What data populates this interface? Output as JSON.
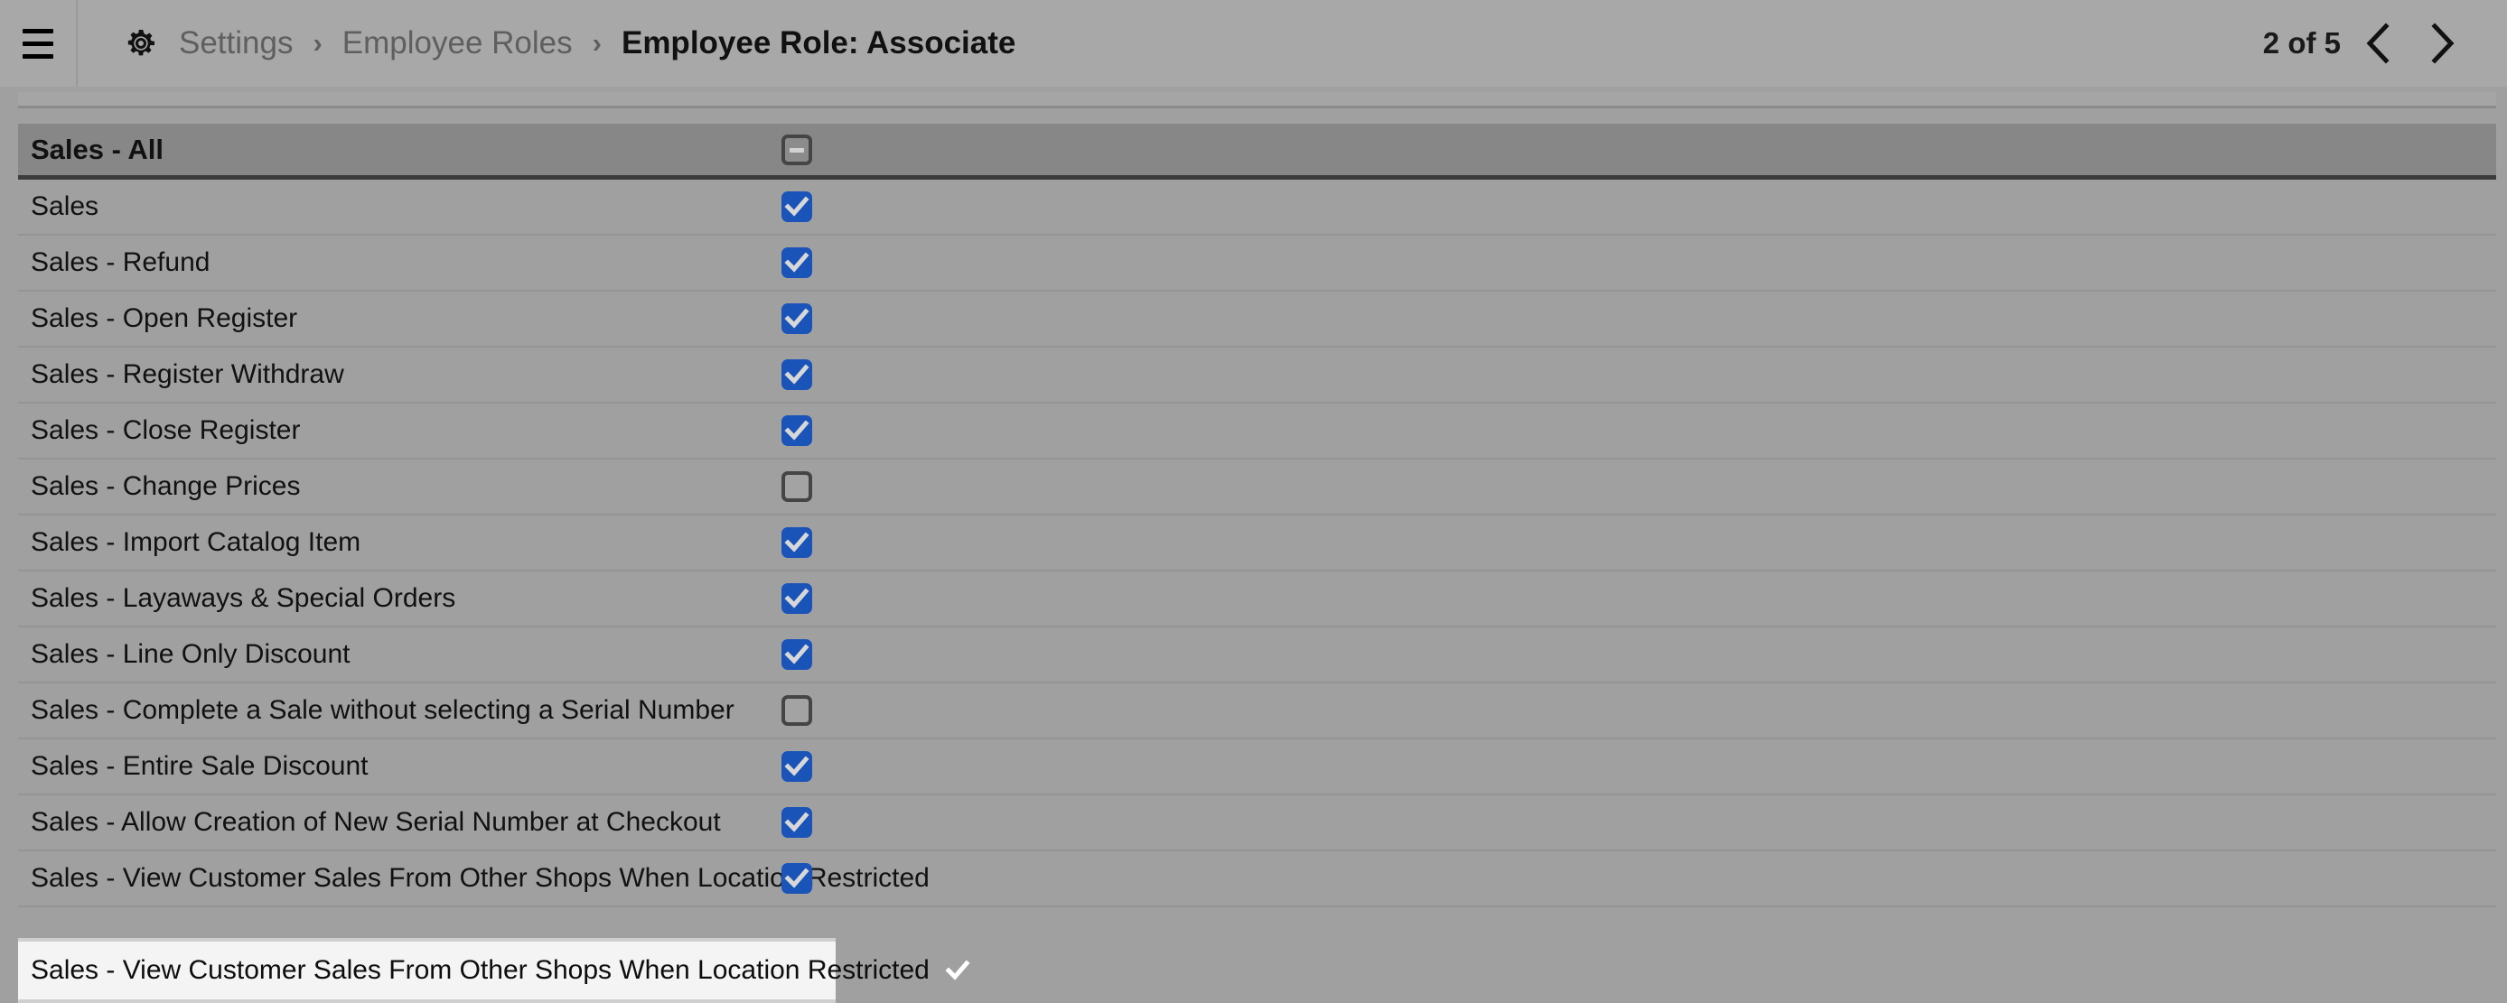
{
  "header": {
    "menu_icon": "hamburger-icon",
    "gear_icon": "gear-icon",
    "breadcrumb": {
      "items": [
        {
          "label": "Settings",
          "current": false
        },
        {
          "label": "Employee Roles",
          "current": false
        }
      ],
      "separator": "›",
      "current_prefix": "Employee Role:",
      "current_value": "Associate"
    },
    "pager": {
      "count_label": "2 of 5",
      "prev_icon": "chevron-left-icon",
      "next_icon": "chevron-right-icon"
    }
  },
  "permissions_table": {
    "group": {
      "label": "Sales - All",
      "checkbox_state": "indeterminate"
    },
    "rows": [
      {
        "label": "Sales",
        "checked": true
      },
      {
        "label": "Sales - Refund",
        "checked": true
      },
      {
        "label": "Sales - Open Register",
        "checked": true
      },
      {
        "label": "Sales - Register Withdraw",
        "checked": true
      },
      {
        "label": "Sales - Close Register",
        "checked": true
      },
      {
        "label": "Sales - Change Prices",
        "checked": false
      },
      {
        "label": "Sales - Import Catalog Item",
        "checked": true
      },
      {
        "label": "Sales - Layaways & Special Orders",
        "checked": true
      },
      {
        "label": "Sales - Line Only Discount",
        "checked": true
      },
      {
        "label": "Sales - Complete a Sale without selecting a Serial Number",
        "checked": false
      },
      {
        "label": "Sales - Entire Sale Discount",
        "checked": true
      },
      {
        "label": "Sales - Allow Creation of New Serial Number at Checkout",
        "checked": true
      },
      {
        "label": "Sales - View Customer Sales From Other Shops When Location Restricted",
        "checked": true
      }
    ]
  },
  "focused_row": {
    "label": "Sales - View Customer Sales From Other Shops When Location Restricted",
    "checked": true
  },
  "colors": {
    "header_bg": "#a8a8a8",
    "row_bg": "#a0a0a0",
    "group_bg": "#878787",
    "checkbox_blue": "#1a54b8",
    "focus_checkbox_blue": "#1a6ff0",
    "focus_overlay_bg": "#f4f4f4"
  }
}
